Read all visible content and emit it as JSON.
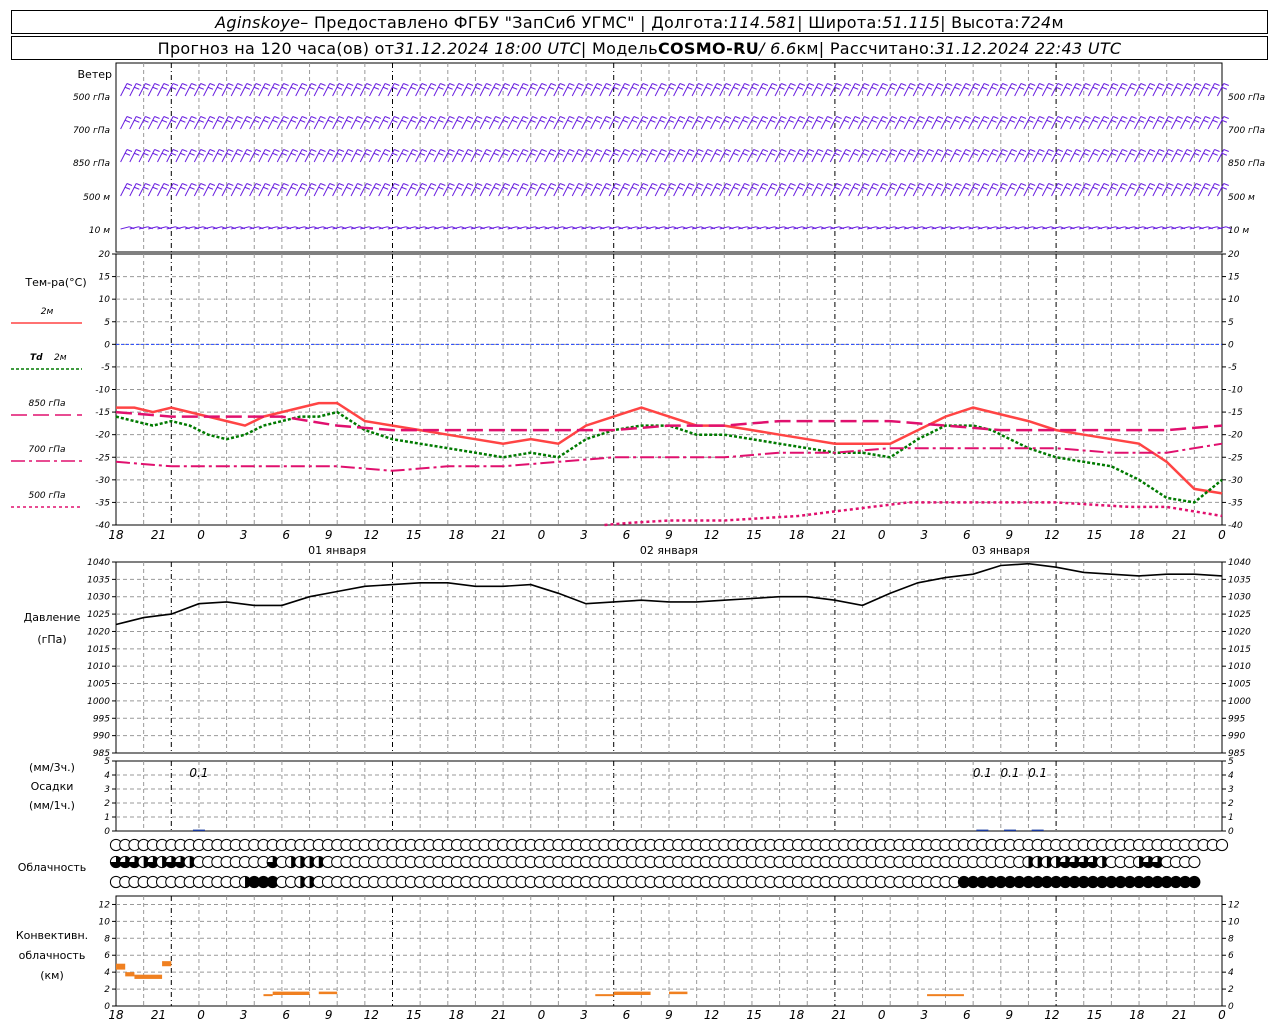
{
  "header": {
    "station": "Aginskoye",
    "provider": " – Предоставлено ФГБУ \"ЗапСиб УГМС\" | Долгота: ",
    "lon": "114.581",
    "lat_label": " | Широта: ",
    "lat": "51.115",
    "alt_label": " | Высота: ",
    "alt": "724",
    "alt_unit": "м",
    "forecast_label": "Прогноз на 120 часа(ов) от ",
    "start": "31.12.2024 18:00 UTC",
    "model_label": " | Модель ",
    "model": "COSMO-RU",
    "res": " / 6.6",
    "res_unit": "км",
    "calc_label": " | Рассчитано: ",
    "calc": "31.12.2024 22:43 UTC"
  },
  "labels": {
    "wind": "Ветер",
    "wind_levels": [
      "500 гПа",
      "700 гПа",
      "850 гПа",
      "500 м",
      "10 м"
    ],
    "temp_title": "Тем-ра(°С)",
    "t2m": "2м",
    "td_a": "Td",
    "td_b": "2м",
    "t850": "850 гПа",
    "t700": "700 гПа",
    "t500": "500 гПа",
    "pressure_a": "Давление",
    "pressure_b": "(гПа)",
    "precip_a": "(мм/3ч.)",
    "precip_b": "Осадки",
    "precip_c": "(мм/1ч.)",
    "clouds": "Облачность",
    "conv_a": "Конвективн.",
    "conv_b": "облачность",
    "conv_c": "(км)"
  },
  "x_ticks": [
    "18",
    "21",
    "0",
    "3",
    "6",
    "9",
    "12",
    "15",
    "18",
    "21",
    "0",
    "3",
    "6",
    "9",
    "12",
    "15",
    "18",
    "21",
    "0",
    "3",
    "6",
    "9",
    "12",
    "15",
    "18",
    "21",
    "0"
  ],
  "dates": [
    "01 января",
    "02 января",
    "03 января"
  ],
  "precip_annotations": [
    {
      "hour": 9,
      "text": "0.1"
    },
    {
      "hour": 94,
      "text": "0.1"
    },
    {
      "hour": 97,
      "text": "0.1"
    },
    {
      "hour": 100,
      "text": "0.1"
    }
  ],
  "colors": {
    "t2m": "#ff4444",
    "td": "#007a00",
    "upper": "#e0106e",
    "wind": "#6a20e0",
    "zero_line": "#2244ff",
    "conv": "#f08020",
    "grid": "#999999"
  },
  "chart_data": [
    {
      "type": "line",
      "title": "Тем-ра(°С)",
      "x_unit": "hours from 31.12.2024 18:00 UTC",
      "ylim": [
        -40,
        20
      ],
      "y_ticks": [
        20,
        15,
        10,
        5,
        0,
        -5,
        -10,
        -15,
        -20,
        -25,
        -30,
        -35,
        -40
      ],
      "series": [
        {
          "name": "2м",
          "x": [
            0,
            2,
            4,
            6,
            8,
            10,
            12,
            14,
            16,
            18,
            20,
            22,
            24,
            27,
            30,
            33,
            36,
            39,
            42,
            45,
            48,
            51,
            54,
            57,
            60,
            63,
            66,
            69,
            72,
            75,
            78,
            81,
            84,
            87,
            90,
            93,
            95,
            97,
            99,
            102,
            105,
            108,
            111,
            114,
            117,
            120
          ],
          "y": [
            -14,
            -14,
            -15,
            -14,
            -15,
            -16,
            -17,
            -18,
            -16,
            -15,
            -14,
            -13,
            -13,
            -17,
            -18,
            -19,
            -20,
            -21,
            -22,
            -21,
            -22,
            -18,
            -16,
            -14,
            -16,
            -18,
            -18,
            -19,
            -20,
            -21,
            -22,
            -22,
            -22,
            -19,
            -16,
            -14,
            -15,
            -16,
            -17,
            -19,
            -20,
            -21,
            -22,
            -26,
            -32,
            -33
          ]
        },
        {
          "name": "Td 2м",
          "x": [
            0,
            2,
            4,
            6,
            8,
            10,
            12,
            14,
            16,
            18,
            20,
            22,
            24,
            27,
            30,
            33,
            36,
            39,
            42,
            45,
            48,
            51,
            54,
            57,
            60,
            63,
            66,
            69,
            72,
            75,
            78,
            81,
            84,
            87,
            90,
            93,
            95,
            97,
            99,
            102,
            105,
            108,
            111,
            114,
            117,
            120
          ],
          "y": [
            -16,
            -17,
            -18,
            -17,
            -18,
            -20,
            -21,
            -20,
            -18,
            -17,
            -16,
            -16,
            -15,
            -19,
            -21,
            -22,
            -23,
            -24,
            -25,
            -24,
            -25,
            -21,
            -19,
            -18,
            -18,
            -20,
            -20,
            -21,
            -22,
            -23,
            -24,
            -24,
            -25,
            -21,
            -18,
            -18,
            -19,
            -21,
            -23,
            -25,
            -26,
            -27,
            -30,
            -34,
            -35,
            -30
          ]
        },
        {
          "name": "850 гПа",
          "x": [
            0,
            6,
            12,
            18,
            24,
            30,
            36,
            42,
            48,
            54,
            60,
            66,
            72,
            78,
            84,
            90,
            96,
            102,
            108,
            114,
            120
          ],
          "y": [
            -15,
            -16,
            -16,
            -16,
            -18,
            -19,
            -19,
            -19,
            -19,
            -19,
            -18,
            -18,
            -17,
            -17,
            -17,
            -18,
            -19,
            -19,
            -19,
            -19,
            -18
          ]
        },
        {
          "name": "700 гПа",
          "x": [
            0,
            6,
            12,
            18,
            24,
            30,
            36,
            42,
            48,
            54,
            60,
            66,
            72,
            78,
            84,
            90,
            96,
            102,
            108,
            114,
            120
          ],
          "y": [
            -26,
            -27,
            -27,
            -27,
            -27,
            -28,
            -27,
            -27,
            -26,
            -25,
            -25,
            -25,
            -24,
            -24,
            -23,
            -23,
            -23,
            -23,
            -24,
            -24,
            -22
          ]
        },
        {
          "name": "500 гПа",
          "x": [
            53,
            56,
            60,
            63,
            66,
            70,
            74,
            78,
            82,
            86,
            90,
            94,
            98,
            102,
            106,
            110,
            114,
            117,
            120
          ],
          "y": [
            -40,
            -39.5,
            -39,
            -39,
            -39,
            -38.5,
            -38,
            -37,
            -36,
            -35,
            -35,
            -35,
            -35,
            -35,
            -35.5,
            -36,
            -36,
            -37,
            -38
          ]
        }
      ]
    },
    {
      "type": "line",
      "title": "Давление",
      "ylabel": "(гПа)",
      "ylim": [
        985,
        1040
      ],
      "y_ticks": [
        1040,
        1035,
        1030,
        1025,
        1020,
        1015,
        1010,
        1005,
        1000,
        995,
        990,
        985
      ],
      "series": [
        {
          "name": "",
          "x": [
            0,
            3,
            6,
            9,
            12,
            15,
            18,
            21,
            24,
            27,
            30,
            33,
            36,
            39,
            42,
            45,
            48,
            51,
            54,
            57,
            60,
            63,
            66,
            69,
            72,
            75,
            78,
            81,
            84,
            87,
            90,
            93,
            96,
            99,
            102,
            105,
            108,
            111,
            114,
            117,
            120
          ],
          "y": [
            1022,
            1024,
            1025,
            1028,
            1028.5,
            1027.5,
            1027.5,
            1030,
            1031.5,
            1033,
            1033.5,
            1034,
            1034,
            1033,
            1033,
            1033.5,
            1031,
            1028,
            1028.5,
            1029,
            1028.5,
            1028.5,
            1029,
            1029.5,
            1030,
            1030,
            1029,
            1027.5,
            1031,
            1034,
            1035.5,
            1036.5,
            1039,
            1039.5,
            1038.5,
            1037,
            1036.5,
            1036,
            1036.5,
            1036.5,
            1036
          ]
        }
      ]
    },
    {
      "type": "bar",
      "title": "Осадки",
      "ylim": [
        0,
        5
      ],
      "y_ticks": [
        5,
        4,
        3,
        2,
        1,
        0
      ],
      "x": [
        9,
        94,
        97,
        100
      ],
      "values": [
        0.1,
        0.1,
        0.1,
        0.1
      ]
    },
    {
      "type": "bar",
      "title": "Конвективн. облачность (км)",
      "ylim": [
        0,
        13
      ],
      "y_ticks": [
        12,
        10,
        8,
        6,
        4,
        2,
        0
      ],
      "bars": [
        {
          "x": 0,
          "x2": 1,
          "base": 4.3,
          "top": 5
        },
        {
          "x": 1,
          "x2": 2,
          "base": 3.5,
          "top": 4
        },
        {
          "x": 2,
          "x2": 5,
          "base": 3.2,
          "top": 3.7
        },
        {
          "x": 5,
          "x2": 6,
          "base": 4.7,
          "top": 5.3
        },
        {
          "x": 16,
          "x2": 17,
          "base": 1.2,
          "top": 1.4
        },
        {
          "x": 17,
          "x2": 21,
          "base": 1.3,
          "top": 1.7
        },
        {
          "x": 22,
          "x2": 24,
          "base": 1.4,
          "top": 1.7
        },
        {
          "x": 52,
          "x2": 54,
          "base": 1.2,
          "top": 1.4
        },
        {
          "x": 54,
          "x2": 58,
          "base": 1.3,
          "top": 1.7
        },
        {
          "x": 60,
          "x2": 62,
          "base": 1.4,
          "top": 1.7
        },
        {
          "x": 88,
          "x2": 92,
          "base": 1.2,
          "top": 1.4
        }
      ]
    }
  ],
  "cloud_rows": [
    "0000000000000000000000000000000000000000000000000000000000000000000000000000000000000000000000000000000000000000000000000",
    "3332323320000000030222200000000000000000000000000000000000000000000000000000000000000000000000000002222333320002330000",
    "0000000000000024440022000000000000000000000000000000000000000000000000000000000000000000000044444444444444444444444444"
  ]
}
